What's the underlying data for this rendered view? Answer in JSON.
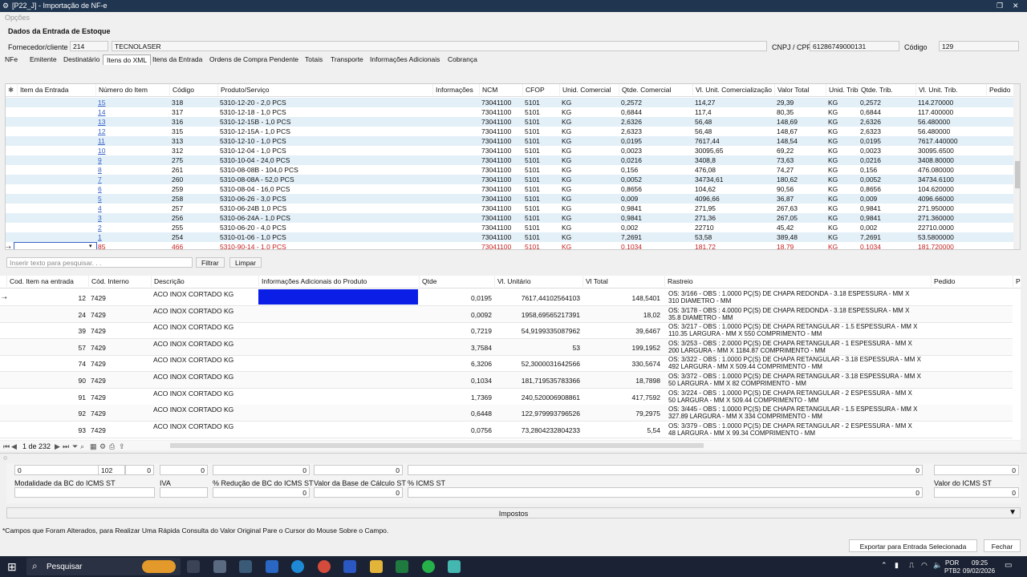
{
  "window": {
    "title": "[P22_J] - Importação de NF-e"
  },
  "menu": {
    "options": "Opções"
  },
  "section_title": "Dados da Entrada de Estoque",
  "supplier": {
    "label": "Fornecedor/cliente",
    "code": "214",
    "name": "TECNOLASER",
    "cnpj_label": "CNPJ / CPF",
    "cnpj": "61286749000131",
    "codigo_label": "Código",
    "codigo": "129"
  },
  "tabs": [
    "NFe",
    "Emitente",
    "Destinatário",
    "Itens do XML",
    "Itens da Entrada",
    "Ordens de Compra Pendente",
    "Totais",
    "Transporte",
    "Informações Adicionais",
    "Cobrança"
  ],
  "active_tab": "Itens do XML",
  "xml_grid": {
    "headers": [
      "Item da Entrada",
      "Número do Item",
      "Código",
      "Produto/Serviço",
      "Informações",
      "NCM",
      "CFOP",
      "Unid. Comercial",
      "Qtde. Comercial",
      "Vl. Unit. Comercialização",
      "Valor Total",
      "Unid. Trib",
      "Qtde. Trib.",
      "Vl. Unit. Trib.",
      "Pedido"
    ],
    "rows": [
      [
        "",
        "15",
        "318",
        "5310-12-20 - 2,0 PCS",
        "",
        "73041100",
        "5101",
        "KG",
        "0,2572",
        "114,27",
        "29,39",
        "KG",
        "0,2572",
        "114.270000"
      ],
      [
        "",
        "14",
        "317",
        "5310-12-18 - 1,0 PCS",
        "",
        "73041100",
        "5101",
        "KG",
        "0,6844",
        "117,4",
        "80,35",
        "KG",
        "0,6844",
        "117.400000"
      ],
      [
        "",
        "13",
        "316",
        "5310-12-15B - 1,0 PCS",
        "",
        "73041100",
        "5101",
        "KG",
        "2,6326",
        "56,48",
        "148,69",
        "KG",
        "2,6326",
        "56.480000"
      ],
      [
        "",
        "12",
        "315",
        "5310-12-15A - 1,0 PCS",
        "",
        "73041100",
        "5101",
        "KG",
        "2,6323",
        "56,48",
        "148,67",
        "KG",
        "2,6323",
        "56.480000"
      ],
      [
        "",
        "11",
        "313",
        "5310-12-10 - 1,0 PCS",
        "",
        "73041100",
        "5101",
        "KG",
        "0,0195",
        "7617,44",
        "148,54",
        "KG",
        "0,0195",
        "7617.440000"
      ],
      [
        "",
        "10",
        "312",
        "5310-12-04 - 1,0 PCS",
        "",
        "73041100",
        "5101",
        "KG",
        "0,0023",
        "30095,65",
        "69,22",
        "KG",
        "0,0023",
        "30095.6500"
      ],
      [
        "",
        "9",
        "275",
        "5310-10-04 - 24,0 PCS",
        "",
        "73041100",
        "5101",
        "KG",
        "0,0216",
        "3408,8",
        "73,63",
        "KG",
        "0,0216",
        "3408.80000"
      ],
      [
        "",
        "8",
        "261",
        "5310-08-08B - 104,0 PCS",
        "",
        "73041100",
        "5101",
        "KG",
        "0,156",
        "476,08",
        "74,27",
        "KG",
        "0,156",
        "476.080000"
      ],
      [
        "",
        "7",
        "260",
        "5310-08-08A - 52,0 PCS",
        "",
        "73041100",
        "5101",
        "KG",
        "0,0052",
        "34734,61",
        "180,62",
        "KG",
        "0,0052",
        "34734.6100"
      ],
      [
        "",
        "6",
        "259",
        "5310-08-04 - 16,0 PCS",
        "",
        "73041100",
        "5101",
        "KG",
        "0,8656",
        "104,62",
        "90,56",
        "KG",
        "0,8656",
        "104.620000"
      ],
      [
        "",
        "5",
        "258",
        "5310-06-26 - 3,0 PCS",
        "",
        "73041100",
        "5101",
        "KG",
        "0,009",
        "4096,66",
        "36,87",
        "KG",
        "0,009",
        "4096.66000"
      ],
      [
        "",
        "4",
        "257",
        "5310-06-24B 1,0 PCS",
        "",
        "73041100",
        "5101",
        "KG",
        "0,9841",
        "271,95",
        "267,63",
        "KG",
        "0,9841",
        "271.950000"
      ],
      [
        "",
        "3",
        "256",
        "5310-06-24A - 1,0 PCS",
        "",
        "73041100",
        "5101",
        "KG",
        "0,9841",
        "271,36",
        "267,05",
        "KG",
        "0,9841",
        "271.360000"
      ],
      [
        "",
        "2",
        "255",
        "5310-06-20 - 4,0 PCS",
        "",
        "73041100",
        "5101",
        "KG",
        "0,002",
        "22710",
        "45,42",
        "KG",
        "0,002",
        "22710.0000"
      ],
      [
        "",
        "1",
        "254",
        "5310-01-06 - 1,0 PCS",
        "",
        "73041100",
        "5101",
        "KG",
        "7,2691",
        "53,58",
        "389,48",
        "KG",
        "7,2691",
        "53.5800000"
      ],
      [
        "",
        "85",
        "466",
        "5310-90-14 - 1,0 PCS",
        "",
        "73041100",
        "5101",
        "KG",
        "0,1034",
        "181,72",
        "18,79",
        "KG",
        "0,1034",
        "181.720000"
      ]
    ]
  },
  "search": {
    "placeholder": "Inserir texto para pesquisar. . .",
    "filter": "Filtrar",
    "clear": "Limpar"
  },
  "detail_grid": {
    "headers": [
      "Cod. Item na entrada",
      "Cód. Interno",
      "Descrição",
      "Informações Adicionais do Produto",
      "Qtde",
      "Vl. Unitário",
      "Vl Total",
      "Rastreio",
      "Pedido",
      "P"
    ],
    "rows": [
      [
        "12",
        "7429",
        "ACO INOX CORTADO KG",
        "",
        "0,0195",
        "7617,44102564103",
        "148,5401",
        "OS: 3/166 - OBS : 1.0000 PÇ(S) DE CHAPA REDONDA - 3.18 ESPESSURA - MM  X",
        "310 DIAMETRO - MM"
      ],
      [
        "24",
        "7429",
        "ACO INOX CORTADO KG",
        "",
        "0,0092",
        "1958,69565217391",
        "18,02",
        "OS: 3/178 - OBS : 4.0000 PÇ(S) DE CHAPA REDONDA - 3.18 ESPESSURA - MM  X",
        "35.8 DIAMETRO - MM"
      ],
      [
        "39",
        "7429",
        "ACO INOX CORTADO KG",
        "",
        "0,7219",
        "54,9199335087962",
        "39,6467",
        "OS: 3/217 - OBS : 1.0000 PÇ(S) DE CHAPA RETANGULAR - 1.5 ESPESSURA - MM  X",
        "110.35 LARGURA - MM  X  550 COMPRIMENTO - MM"
      ],
      [
        "57",
        "7429",
        "ACO INOX CORTADO KG",
        "",
        "3,7584",
        "53",
        "199,1952",
        "OS: 3/253 - OBS : 2.0000 PÇ(S) DE CHAPA RETANGULAR - 1 ESPESSURA - MM  X",
        "200 LARGURA - MM  X  1184.87 COMPRIMENTO - MM"
      ],
      [
        "74",
        "7429",
        "ACO INOX CORTADO KG",
        "",
        "6,3206",
        "52,3000031642566",
        "330,5674",
        "OS: 3/322 - OBS : 1.0000 PÇ(S) DE CHAPA RETANGULAR - 3.18 ESPESSURA - MM  X",
        "492 LARGURA - MM  X  509.44 COMPRIMENTO - MM"
      ],
      [
        "90",
        "7429",
        "ACO INOX CORTADO KG",
        "",
        "0,1034",
        "181,719535783366",
        "18,7898",
        "OS: 3/372 - OBS : 1.0000 PÇ(S) DE CHAPA RETANGULAR - 3.18 ESPESSURA - MM  X",
        "50 LARGURA - MM  X  82 COMPRIMENTO - MM"
      ],
      [
        "91",
        "7429",
        "ACO INOX CORTADO KG",
        "",
        "1,7369",
        "240,520006908861",
        "417,7592",
        "OS: 3/224 - OBS : 1.0000 PÇ(S) DE CHAPA RETANGULAR - 2 ESPESSURA - MM  X",
        "50 LARGURA - MM  X  509.44 COMPRIMENTO - MM"
      ],
      [
        "92",
        "7429",
        "ACO INOX CORTADO KG",
        "",
        "0,6448",
        "122,979993796526",
        "79,2975",
        "OS: 3/445 - OBS : 1.0000 PÇ(S) DE CHAPA RETANGULAR - 1.5 ESPESSURA - MM  X",
        "327.89 LARGURA - MM  X  334 COMPRIMENTO - MM"
      ],
      [
        "93",
        "7429",
        "ACO INOX CORTADO KG",
        "",
        "0,0756",
        "73,2804232804233",
        "5,54",
        "OS: 3/379 - OBS : 1.0000 PÇ(S) DE CHAPA RETANGULAR - 2 ESPESSURA - MM  X",
        "48 LARGURA - MM  X  99.34 COMPRIMENTO - MM"
      ]
    ]
  },
  "pager": {
    "text": "1 de 232"
  },
  "taxes": {
    "row1": [
      "0",
      "102",
      "0",
      "0",
      "0",
      "0",
      "0",
      "0"
    ],
    "labels": [
      "Modalidade da BC do ICMS ST",
      "IVA",
      "% Redução de BC do ICMS ST",
      "Valor da Base de Cálculo ST",
      "% ICMS ST",
      "Valor do ICMS ST"
    ],
    "row2": [
      "",
      "",
      "0",
      "0",
      "0",
      "0"
    ],
    "section": "Impostos"
  },
  "footnote": "*Campos que Foram Alterados, para Realizar Uma Rápida Consulta do Valor Original Pare o Cursor do Mouse Sobre o Campo.",
  "buttons": {
    "export": "Exportar para Entrada Selecionada",
    "close": "Fechar"
  },
  "taskbar": {
    "search": "Pesquisar",
    "lang1": "POR",
    "lang2": "PTB2",
    "time": "09:25",
    "date": "09/02/2026"
  },
  "colors": {
    "titlebar": "#1f3550",
    "selection": "#0a1ee6",
    "link": "#3a63c8",
    "alt_row": "#e3f0f8",
    "highlight_row_text": "#c81e1e"
  }
}
